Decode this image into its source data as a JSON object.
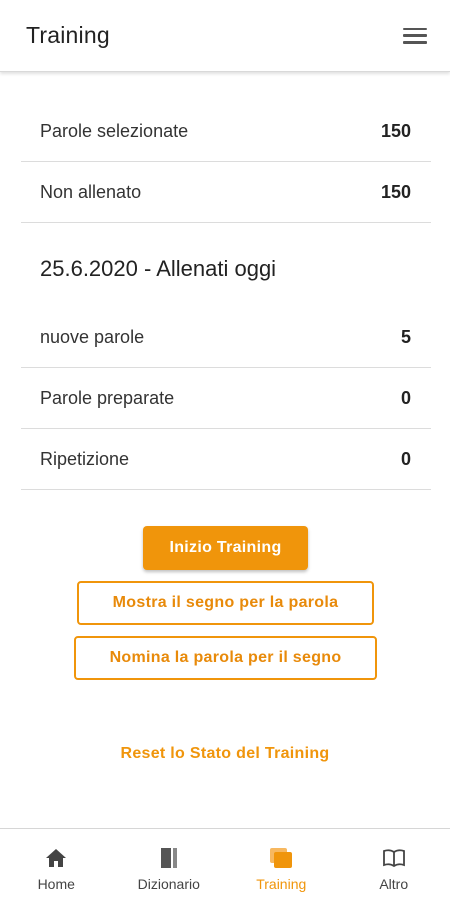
{
  "header": {
    "title": "Training",
    "menu_icon": "hamburger-menu-icon"
  },
  "stats": [
    {
      "label": "Parole selezionate",
      "value": "150"
    },
    {
      "label": "Non allenato",
      "value": "150"
    }
  ],
  "today": {
    "title": "25.6.2020 - Allenati oggi",
    "items": [
      {
        "label": "nuove parole",
        "value": "5"
      },
      {
        "label": "Parole preparate",
        "value": "0"
      },
      {
        "label": "Ripetizione",
        "value": "0"
      }
    ]
  },
  "actions": {
    "start": "Inizio Training",
    "show_sign": "Mostra il segno per la parola",
    "name_word": "Nomina la parola per il segno",
    "reset": "Reset lo Stato del Training"
  },
  "nav": {
    "items": [
      {
        "label": "Home",
        "icon": "home-icon"
      },
      {
        "label": "Dizionario",
        "icon": "dictionary-icon"
      },
      {
        "label": "Training",
        "icon": "training-icon",
        "active": true
      },
      {
        "label": "Altro",
        "icon": "book-open-icon"
      }
    ]
  },
  "colors": {
    "accent": "#f0950b",
    "text": "#222222",
    "divider": "#dcdcdc",
    "nav_inactive": "#444444"
  }
}
